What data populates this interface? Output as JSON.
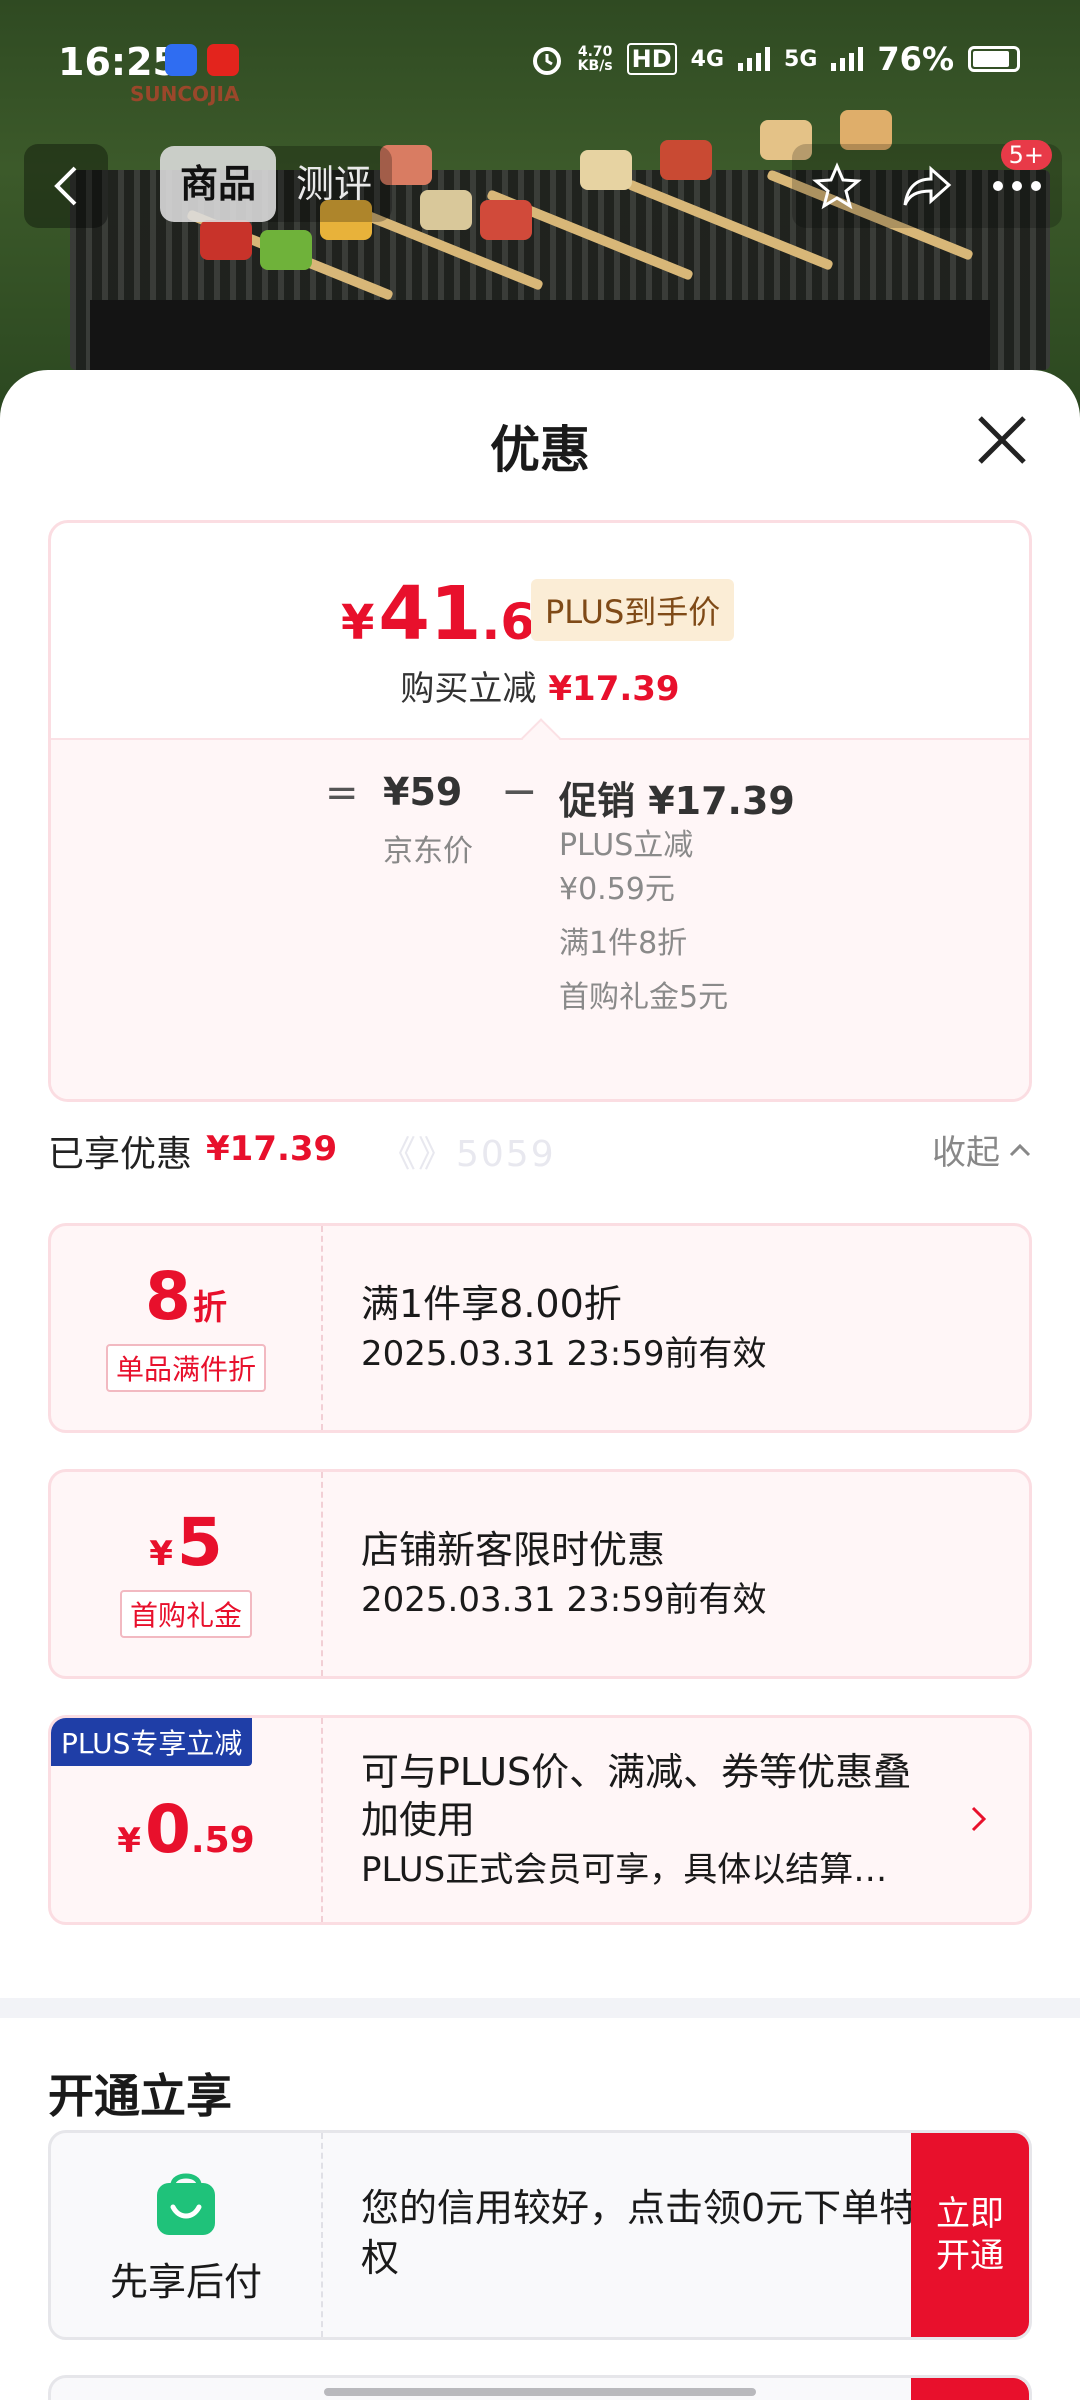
{
  "status_bar": {
    "time": "16:25",
    "net_speed": "4.70",
    "net_speed_unit": "KB/s",
    "hd": "HD",
    "signal1": "4G",
    "signal2": "5G",
    "battery": "76%"
  },
  "background_watermark": "SUNCOJIA",
  "nav": {
    "tabs": [
      "商品",
      "测评"
    ],
    "active_tab": "商品",
    "message_badge": "5+"
  },
  "sheet": {
    "title": "优惠",
    "price_card": {
      "final_yen": "¥",
      "final_int": "41",
      "final_dec": ".61",
      "plus_tag": "PLUS到手价",
      "instant_label": "购买立减",
      "instant_value": "¥17.39",
      "equals": "=",
      "jd_price": "¥59",
      "jd_label": "京东价",
      "minus": "−",
      "promo_head": "促销 ¥17.39",
      "promo_lines": [
        "PLUS立减¥0.59元",
        "满1件8折",
        "首购礼金5元"
      ]
    },
    "enjoyed": {
      "label": "已享优惠",
      "value": "¥17.39",
      "collapse": "收起"
    },
    "watermark": "《》5059",
    "coupons": [
      {
        "amount": "8",
        "unit": "折",
        "tag": "单品满件折",
        "title": "满1件享8.00折",
        "sub": "2025.03.31 23:59前有效"
      },
      {
        "yen": "¥",
        "amount": "5",
        "tag": "首购礼金",
        "title": "店铺新客限时优惠",
        "sub": "2025.03.31 23:59前有效"
      },
      {
        "ribbon": "PLUS专享立减",
        "yen": "¥",
        "amount": "0",
        "decimal": ".59",
        "title": "可与PLUS价、满减、券等优惠叠加使用",
        "sub": "PLUS正式会员可享，具体以结算…"
      }
    ],
    "section_title": "开通立享",
    "pay_card": {
      "name": "先享后付",
      "text": "您的信用较好，点击领0元下单特权",
      "button": "立即开通"
    }
  },
  "colors": {
    "accent_red": "#e8102c",
    "plus_blue": "#1f3ea7",
    "coupon_bg": "#fff6f7",
    "pay_green": "#1fc27a"
  }
}
